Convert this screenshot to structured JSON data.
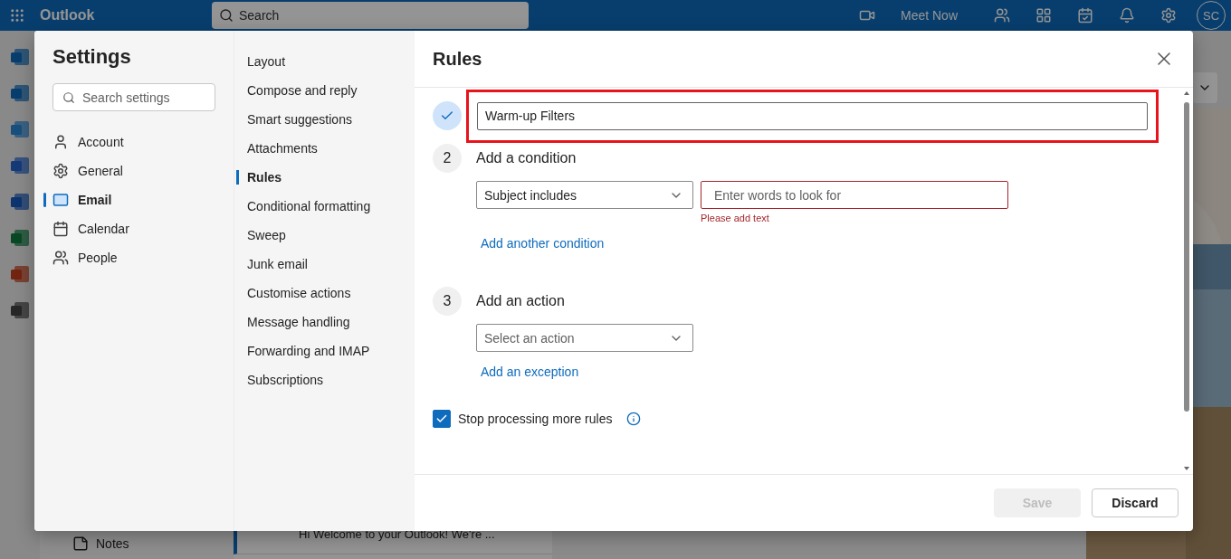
{
  "app_bar": {
    "title": "Outlook",
    "search": {
      "placeholder": "Search"
    },
    "meet_now": "Meet Now",
    "avatar": "SC"
  },
  "folder_pane": {
    "bottom_item": "Notes"
  },
  "message_list": {
    "preview": "Hi Welcome to your Outlook! We're ..."
  },
  "settings": {
    "title": "Settings",
    "search": {
      "placeholder": "Search settings"
    },
    "categories": [
      {
        "label": "Account",
        "selected": false
      },
      {
        "label": "General",
        "selected": false
      },
      {
        "label": "Email",
        "selected": true
      },
      {
        "label": "Calendar",
        "selected": false
      },
      {
        "label": "People",
        "selected": false
      }
    ],
    "sections": [
      {
        "label": "Layout",
        "selected": false
      },
      {
        "label": "Compose and reply",
        "selected": false
      },
      {
        "label": "Smart suggestions",
        "selected": false
      },
      {
        "label": "Attachments",
        "selected": false
      },
      {
        "label": "Rules",
        "selected": true
      },
      {
        "label": "Conditional formatting",
        "selected": false
      },
      {
        "label": "Sweep",
        "selected": false
      },
      {
        "label": "Junk email",
        "selected": false
      },
      {
        "label": "Customise actions",
        "selected": false
      },
      {
        "label": "Message handling",
        "selected": false
      },
      {
        "label": "Forwarding and IMAP",
        "selected": false
      },
      {
        "label": "Subscriptions",
        "selected": false
      }
    ],
    "rules": {
      "title": "Rules",
      "name_step": {
        "done": true,
        "value": "Warm-up Filters",
        "highlighted": true
      },
      "condition_step": {
        "number": "2",
        "title": "Add a condition",
        "select": {
          "value": "Subject includes"
        },
        "text_field": {
          "placeholder": "Enter words to look for",
          "error": "Please add text"
        },
        "link": "Add another condition"
      },
      "action_step": {
        "number": "3",
        "title": "Add an action",
        "select": {
          "placeholder": "Select an action"
        },
        "link": "Add an exception"
      },
      "stop_processing": {
        "label": "Stop processing more rules",
        "checked": true
      },
      "buttons": [
        {
          "label": "Save",
          "disabled": true
        },
        {
          "label": "Discard",
          "disabled": false
        }
      ]
    }
  }
}
